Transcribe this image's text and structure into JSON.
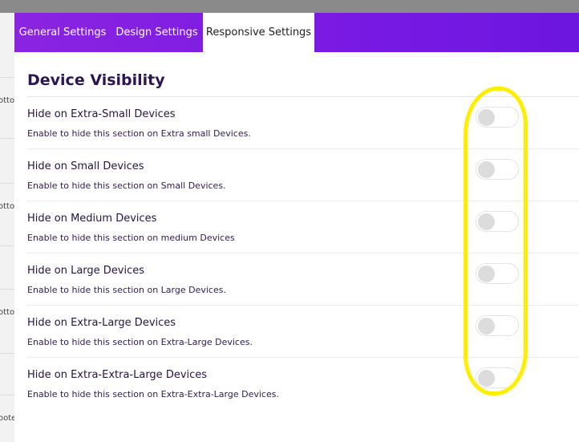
{
  "backdrop": {
    "fragments": [
      "otto",
      "otto",
      "otto",
      "oote"
    ]
  },
  "tabs": [
    {
      "label": "General Settings",
      "active": false
    },
    {
      "label": "Design Settings",
      "active": false
    },
    {
      "label": "Responsive Settings",
      "active": true
    }
  ],
  "section": {
    "title": "Device Visibility"
  },
  "settings": [
    {
      "label": "Hide on Extra-Small Devices",
      "description": "Enable to hide this section on Extra small Devices.",
      "enabled": false
    },
    {
      "label": "Hide on Small Devices",
      "description": "Enable to hide this section on Small Devices.",
      "enabled": false
    },
    {
      "label": "Hide on Medium Devices",
      "description": "Enable to hide this section on medium Devices",
      "enabled": false
    },
    {
      "label": "Hide on Large Devices",
      "description": "Enable to hide this section on Large Devices.",
      "enabled": false
    },
    {
      "label": "Hide on Extra-Large Devices",
      "description": "Enable to hide this section on Extra-Large Devices.",
      "enabled": false
    },
    {
      "label": "Hide on Extra-Extra-Large Devices",
      "description": "Enable to hide this section on Extra-Extra-Large Devices.",
      "enabled": false
    }
  ],
  "colors": {
    "tabbar_start": "#8b24e2",
    "tabbar_end": "#6c16e0",
    "title": "#2b1552",
    "annotation": "#ffee00"
  }
}
